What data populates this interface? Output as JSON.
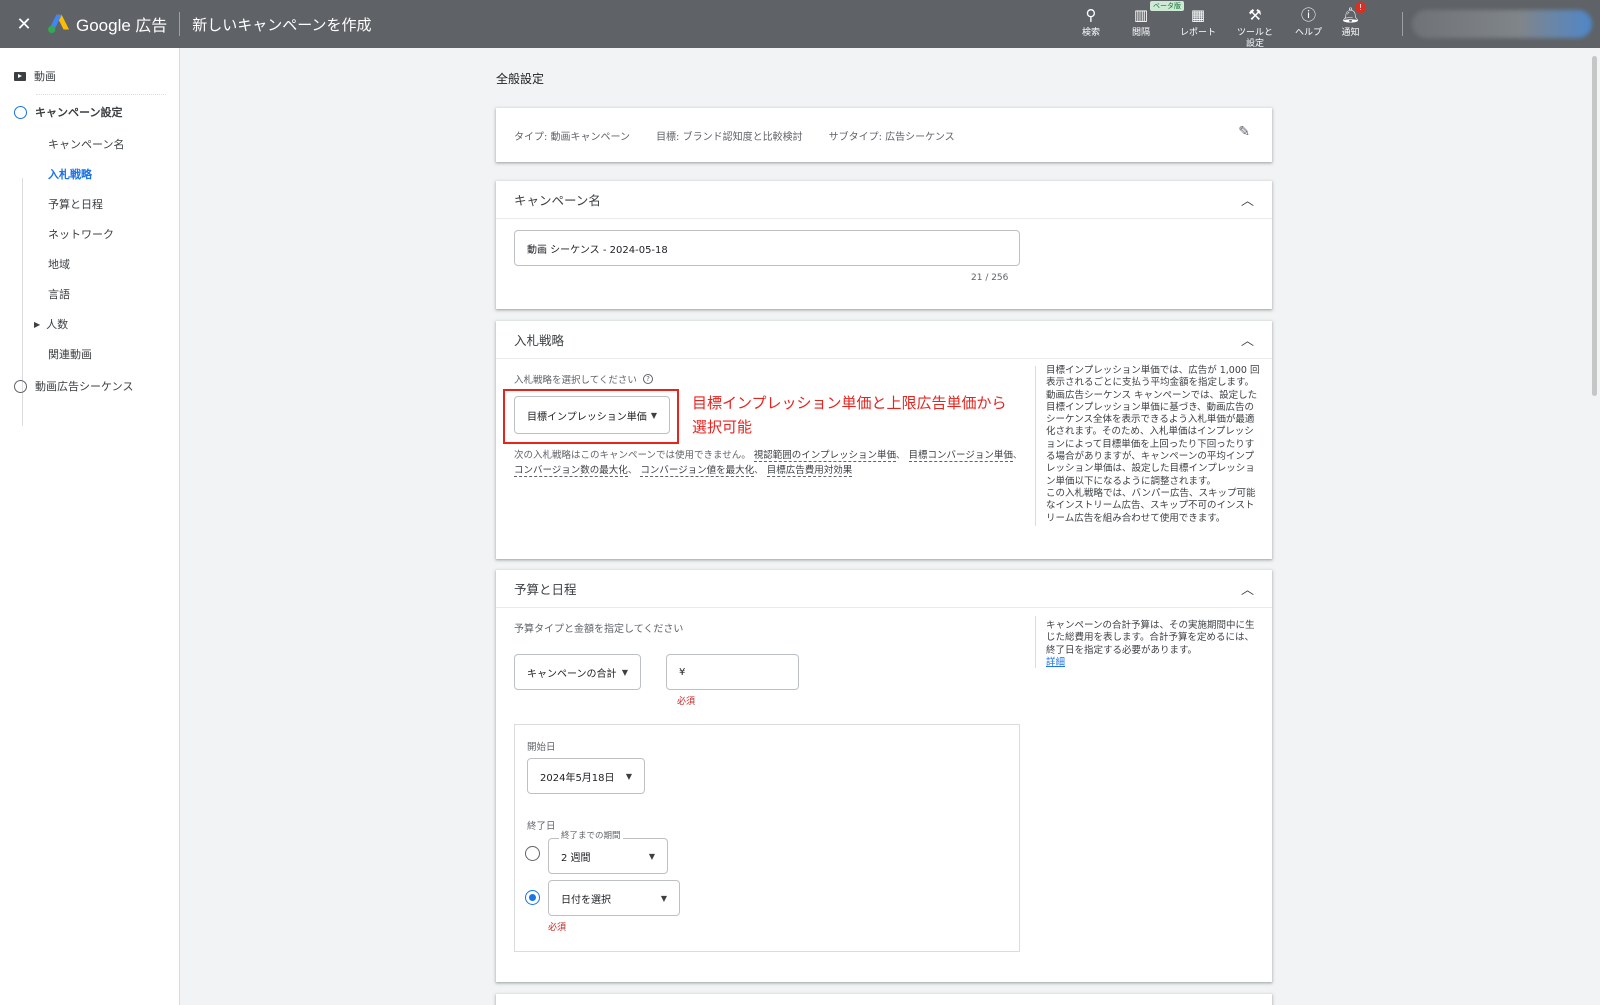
{
  "topbar": {
    "brand_g": "Google",
    "brand_ads": "広告",
    "title": "新しいキャンペーンを作成",
    "tools": [
      {
        "label": "検索",
        "icon": "search-icon"
      },
      {
        "label": "閲隔",
        "icon": "appearance-icon",
        "beta": "ベータ版"
      },
      {
        "label": "レポート",
        "icon": "report-icon"
      },
      {
        "label": "ツールと",
        "label2": "設定",
        "icon": "wrench-icon"
      },
      {
        "label": "ヘルプ",
        "icon": "help-icon"
      },
      {
        "label": "通知",
        "icon": "bell-icon",
        "badge": "!"
      }
    ]
  },
  "sidebar": {
    "video": "動画",
    "campaign_settings": "キャンペーン設定",
    "items": [
      "キャンペーン名",
      "入札戦略",
      "予算と日程",
      "ネットワーク",
      "地域",
      "言語",
      "人数",
      "関連動画"
    ],
    "sequence": "動画広告シーケンス"
  },
  "main": {
    "section_title": "全般設定",
    "summary": {
      "type": "タイプ: 動画キャンペーン",
      "goal": "目標: ブランド認知度と比較検討",
      "subtype": "サブタイプ: 広告シーケンス"
    },
    "campaign_name": {
      "header": "キャンペーン名",
      "value": "動画 シーケンス - 2024-05-18",
      "counter": "21 / 256"
    },
    "bidding": {
      "header": "入札戦略",
      "prompt": "入札戦略を選択してください",
      "selected": "目標インプレッション単価",
      "annotation_line1": "目標インプレッション単価と上限広告単価から",
      "annotation_line2": "選択可能",
      "unavailable_prefix": "次の入札戦略はこのキャンペーンでは使用できません。",
      "unavailable_links": [
        "視認範囲のインプレッション単価",
        "目標コンバージョン単価",
        "コンバージョン数の最大化",
        "コンバージョン値を最大化",
        "目標広告費用対効果"
      ],
      "help_lines": [
        "目標インプレッション単価では、広告が 1,000 回",
        "表示されるごとに支払う平均金額を指定します。",
        "動画広告シーケンス キャンペーンでは、設定した",
        "目標インプレッション単価に基づき、動画広告の",
        "シーケンス全体を表示できるよう入札単価が最適",
        "化されます。そのため、入札単価はインプレッシ",
        "ョンによって目標単価を上回ったり下回ったりす",
        "る場合がありますが、キャンペーンの平均インプ",
        "レッション単価は、設定した目標インプレッショ",
        "ン単価以下になるように調整されます。",
        "この入札戦略では、バンパー広告、スキップ可能",
        "なインストリーム広告、スキップ不可のインスト",
        "リーム広告を組み合わせて使用できます。"
      ]
    },
    "budget": {
      "header": "予算と日程",
      "prompt": "予算タイプと金額を指定してください",
      "type": "キャンペーンの合計",
      "currency": "¥",
      "required": "必須",
      "help_lines": [
        "キャンペーンの合計予算は、その実施期間中に生",
        "じた総費用を表します。合計予算を定めるには、",
        "終了日を指定する必要があります。"
      ],
      "help_link": "詳細",
      "start_label": "開始日",
      "start_value": "2024年5月18日",
      "end_label": "終了日",
      "period_label": "終了までの期間",
      "period_value": "2 週間",
      "date_choice": "日付を選択",
      "date_required": "必須"
    }
  }
}
